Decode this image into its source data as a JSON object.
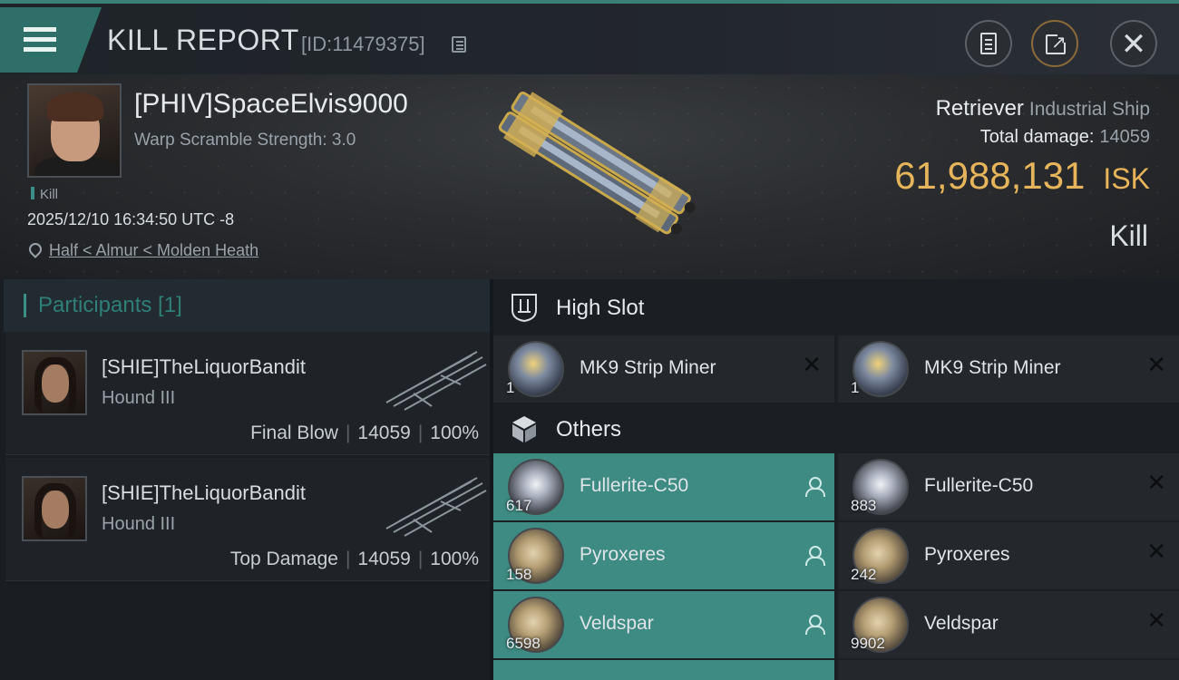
{
  "header": {
    "title": "KILL REPORT",
    "report_id": "[ID:11479375]",
    "icons": [
      "menu-icon",
      "copy-icon",
      "clipboard-icon",
      "share-icon",
      "close-icon"
    ]
  },
  "victim": {
    "name": "[PHIV]SpaceElvis9000",
    "warp_scramble": "Warp Scramble Strength: 3.0",
    "tag": "Kill",
    "datetime": "2025/12/10 16:34:50 UTC -8",
    "location": "Half < Almur < Molden Heath",
    "ship_name": "Retriever",
    "ship_class": "Industrial Ship",
    "total_damage_label": "Total damage:",
    "total_damage": "14059",
    "isk_value": "61,988,131",
    "isk_unit": "ISK",
    "result": "Kill"
  },
  "participants": {
    "title": "Participants [1]",
    "rows": [
      {
        "name": "[SHIE]TheLiquorBandit",
        "ship": "Hound III",
        "role": "Final Blow",
        "damage": "14059",
        "percent": "100%"
      },
      {
        "name": "[SHIE]TheLiquorBandit",
        "ship": "Hound III",
        "role": "Top Damage",
        "damage": "14059",
        "percent": "100%"
      }
    ]
  },
  "slots": {
    "high_slot_label": "High Slot",
    "others_label": "Others",
    "high_slot_items": [
      {
        "qty": "1",
        "name": "MK9 Strip Miner",
        "status": "destroyed"
      },
      {
        "qty": "1",
        "name": "MK9 Strip Miner",
        "status": "destroyed"
      }
    ],
    "others_items": [
      {
        "qty": "617",
        "name": "Fullerite-C50",
        "status": "dropped"
      },
      {
        "qty": "883",
        "name": "Fullerite-C50",
        "status": "destroyed"
      },
      {
        "qty": "158",
        "name": "Pyroxeres",
        "status": "dropped"
      },
      {
        "qty": "242",
        "name": "Pyroxeres",
        "status": "destroyed"
      },
      {
        "qty": "6598",
        "name": "Veldspar",
        "status": "dropped"
      },
      {
        "qty": "9902",
        "name": "Veldspar",
        "status": "destroyed"
      }
    ]
  },
  "colors": {
    "accent_teal": "#3d8b82",
    "isk_gold": "#e6b45a",
    "header_bg": "#1e2328"
  }
}
